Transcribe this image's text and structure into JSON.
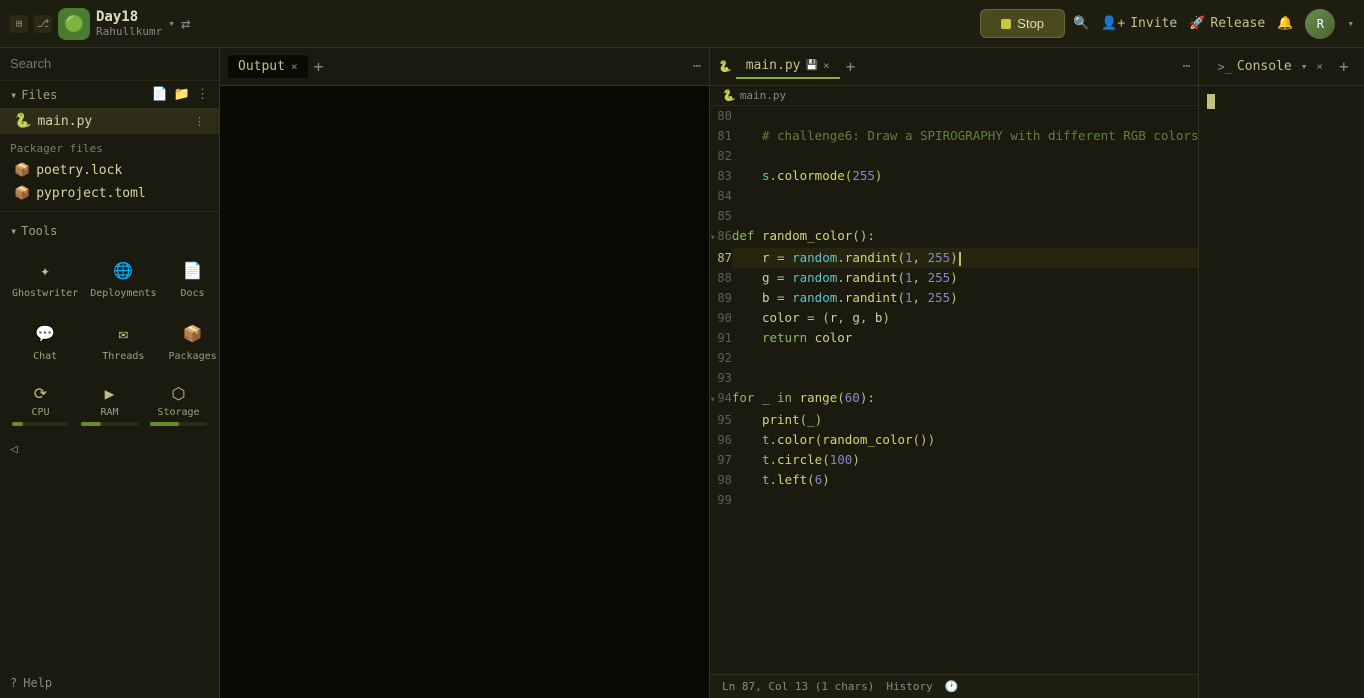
{
  "topbar": {
    "project_icon": "🟢",
    "project_name": "Day18",
    "project_user": "Rahullkumr",
    "chevron": "▾",
    "arrows_icon": "⇄",
    "stop_label": "Stop",
    "search_icon": "🔍",
    "invite_label": "Invite",
    "release_label": "Release",
    "bell_icon": "🔔",
    "avatar_initials": "R"
  },
  "sidebar": {
    "search_placeholder": "Search",
    "files_section": "Files",
    "active_file": "main.py",
    "packager_section": "Packager files",
    "packager_files": [
      {
        "name": "poetry.lock",
        "icon": "📦"
      },
      {
        "name": "pyproject.toml",
        "icon": "📦"
      }
    ],
    "tools_section": "Tools",
    "tools": [
      {
        "label": "Ghostwriter",
        "icon": "✦"
      },
      {
        "label": "Deployments",
        "icon": "🌐"
      },
      {
        "label": "Docs",
        "icon": "📄"
      },
      {
        "label": "Chat",
        "icon": "💬"
      },
      {
        "label": "Threads",
        "icon": "✉"
      },
      {
        "label": "Packages",
        "icon": "📦"
      }
    ],
    "resources": [
      {
        "label": "CPU",
        "icon": "⟳",
        "fill_pct": 20
      },
      {
        "label": "RAM",
        "icon": "▶",
        "fill_pct": 35
      },
      {
        "label": "Storage",
        "icon": "⬡",
        "fill_pct": 50
      }
    ],
    "help_label": "Help"
  },
  "output_panel": {
    "tab_label": "Output",
    "tab_close": "×",
    "add_icon": "+"
  },
  "code_panel": {
    "file_tab": "main.py",
    "tab_close": "×",
    "add_icon": "+",
    "breadcrumb_icon": "🐍",
    "lines": [
      {
        "num": 80,
        "content": ""
      },
      {
        "num": 81,
        "content": "    # challenge6: Draw a SPIROGRAPHY with different RGB colors",
        "type": "comment"
      },
      {
        "num": 82,
        "content": ""
      },
      {
        "num": 83,
        "content": "    s.colormode(255)",
        "type": "code"
      },
      {
        "num": 84,
        "content": ""
      },
      {
        "num": 85,
        "content": ""
      },
      {
        "num": 86,
        "content": "def random_color():",
        "type": "def",
        "foldable": true
      },
      {
        "num": 87,
        "content": "    r = random.randint(1, 255)",
        "type": "code",
        "active": true
      },
      {
        "num": 88,
        "content": "    g = random.randint(1, 255)",
        "type": "code"
      },
      {
        "num": 89,
        "content": "    b = random.randint(1, 255)",
        "type": "code"
      },
      {
        "num": 90,
        "content": "    color = (r, g, b)",
        "type": "code"
      },
      {
        "num": 91,
        "content": "    return color",
        "type": "code"
      },
      {
        "num": 92,
        "content": ""
      },
      {
        "num": 93,
        "content": ""
      },
      {
        "num": 94,
        "content": "for _ in range(60):",
        "type": "for",
        "foldable": true
      },
      {
        "num": 95,
        "content": "    print(_)",
        "type": "code"
      },
      {
        "num": 96,
        "content": "    t.color(random_color())",
        "type": "code"
      },
      {
        "num": 97,
        "content": "    t.circle(100)",
        "type": "code"
      },
      {
        "num": 98,
        "content": "    t.left(6)",
        "type": "code"
      },
      {
        "num": 99,
        "content": ""
      }
    ],
    "status_bar": {
      "ln": "Ln 87, Col 13 (1 chars)",
      "history": "History"
    }
  },
  "console_panel": {
    "tab_label": "Console",
    "tab_close": "×",
    "add_icon": "+"
  }
}
